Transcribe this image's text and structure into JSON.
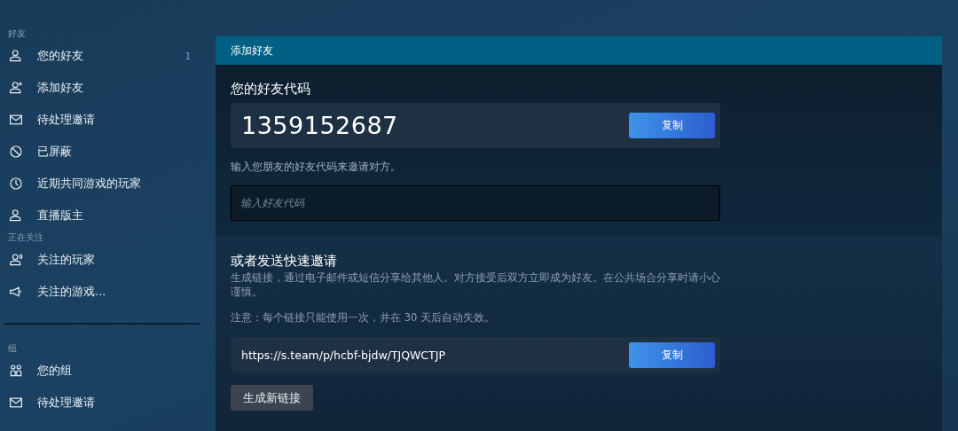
{
  "sidebar": {
    "sections": [
      {
        "heading": "好友",
        "items": [
          {
            "kind": "person",
            "label": "您的好友",
            "count": "1"
          },
          {
            "kind": "person-add",
            "label": "添加好友"
          },
          {
            "kind": "mail",
            "label": "待处理邀请"
          },
          {
            "kind": "blocked",
            "label": "已屏蔽"
          },
          {
            "kind": "clock",
            "label": "近期共同游戏的玩家"
          },
          {
            "kind": "person",
            "label": "直播版主"
          }
        ]
      },
      {
        "heading": "正在关注",
        "items": [
          {
            "kind": "person-follow",
            "label": "关注的玩家"
          },
          {
            "kind": "megaphone",
            "label": "关注的游戏..."
          }
        ]
      },
      {
        "heading": "组",
        "divider": true,
        "items": [
          {
            "kind": "group",
            "label": "您的组"
          },
          {
            "kind": "mail",
            "label": "待处理邀请"
          }
        ]
      }
    ]
  },
  "panel": {
    "title": "添加好友",
    "code_section": {
      "heading": "您的好友代码",
      "code": "1359152687",
      "copy_button": "复制",
      "hint": "输入您朋友的好友代码来邀请对方。",
      "input": {
        "placeholder": "输入好友代码"
      }
    },
    "invite_section": {
      "heading": "或者发送快速邀请",
      "description": "生成链接，通过电子邮件或短信分享给其他人。对方接受后双方立即成为好友。在公共场合分享时请小心谨慎。",
      "note": "注意：每个链接只能使用一次，并在 30 天后自动失效。",
      "link": "https://s.team/p/hcbf-bjdw/TJQWCTJP",
      "copy_button": "复制",
      "new_link_button": "生成新链接"
    }
  }
}
